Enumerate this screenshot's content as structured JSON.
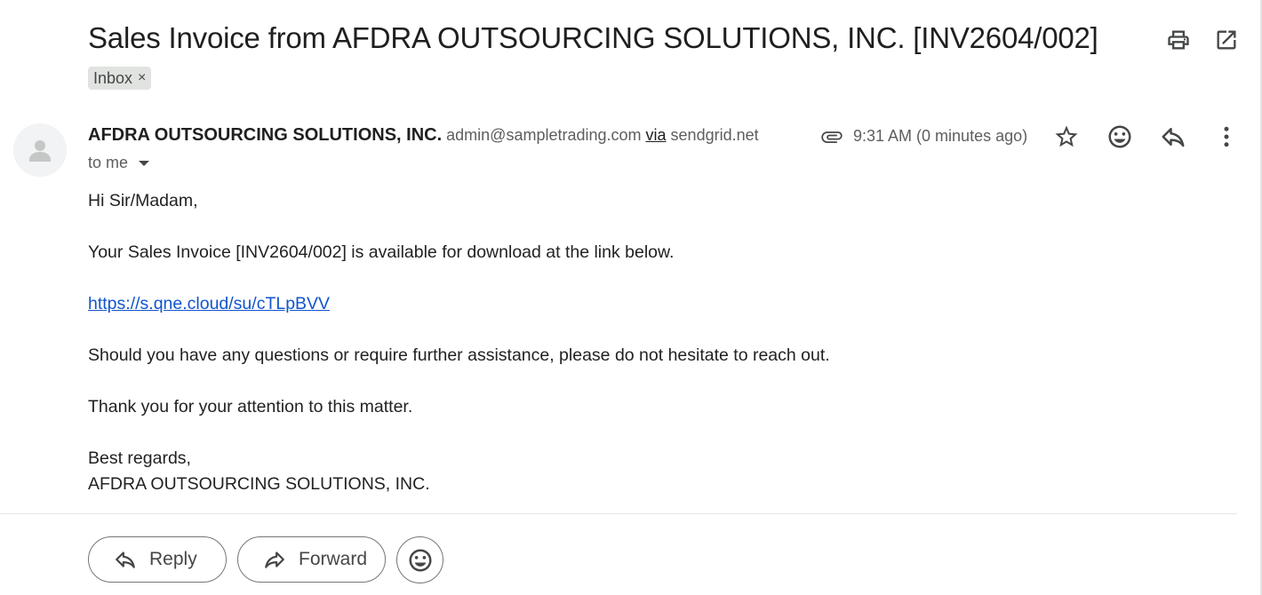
{
  "email": {
    "subject": "Sales Invoice from AFDRA OUTSOURCING SOLUTIONS, INC. [INV2604/002]",
    "label": "Inbox",
    "label_remove": "×",
    "sender_name": "AFDRA OUTSOURCING SOLUTIONS, INC.",
    "sender_email": "admin@sampletrading.com",
    "via_label": "via",
    "via_domain": "sendgrid.net",
    "recipient": "to me",
    "time": "9:31 AM (0 minutes ago)",
    "body": {
      "greeting": "Hi Sir/Madam,",
      "line1": "Your Sales Invoice [INV2604/002] is available for download at the link below.",
      "link": "https://s.qne.cloud/su/cTLpBVV",
      "line2": "Should you have any questions or require further assistance, please do not hesitate to reach out.",
      "line3": "Thank you for your attention to this matter.",
      "closing": "Best regards,",
      "signature": "AFDRA OUTSOURCING SOLUTIONS, INC."
    }
  },
  "actions": {
    "reply_label": "Reply",
    "forward_label": "Forward"
  },
  "icons": {
    "print": "print-icon",
    "open_new_window": "open-in-new-icon",
    "attachment": "paperclip-icon",
    "star": "star-icon",
    "emoji": "emoji-icon",
    "reply": "reply-icon",
    "more": "more-vert-icon",
    "forward": "forward-icon"
  },
  "colors": {
    "link": "#1155cc",
    "chip_bg": "#e1e3e1",
    "icon": "#444746"
  }
}
